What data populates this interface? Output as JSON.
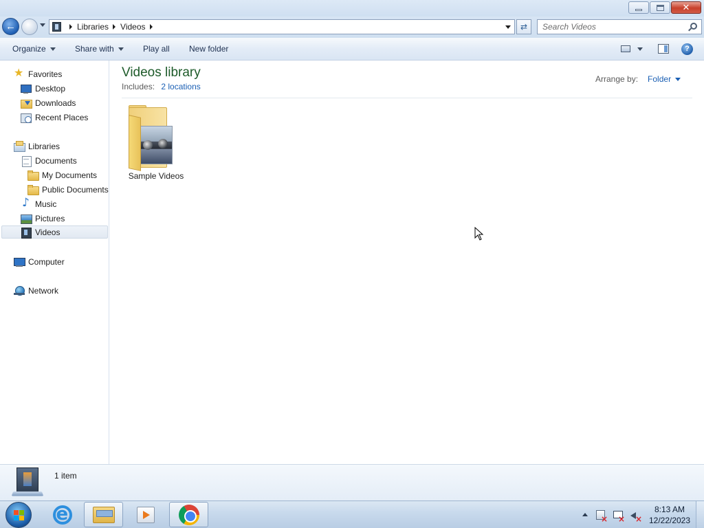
{
  "window": {
    "caption_buttons": [
      "minimize-icon",
      "restore-icon",
      "close-icon"
    ]
  },
  "address": {
    "breadcrumbs": [
      "Libraries",
      "Videos"
    ],
    "search_placeholder": "Search Videos"
  },
  "commandbar": {
    "organize": "Organize",
    "share_with": "Share with",
    "play_all": "Play all",
    "new_folder": "New folder"
  },
  "navpane": {
    "favorites": {
      "label": "Favorites",
      "items": [
        "Desktop",
        "Downloads",
        "Recent Places"
      ]
    },
    "libraries": {
      "label": "Libraries",
      "documents": "Documents",
      "document_children": [
        "My Documents",
        "Public Documents"
      ],
      "items": [
        "Music",
        "Pictures",
        "Videos"
      ],
      "selected": "Videos"
    },
    "computer": "Computer",
    "network": "Network"
  },
  "content": {
    "title": "Videos library",
    "includes_label": "Includes:",
    "includes_link": "2 locations",
    "arrange_label": "Arrange by:",
    "arrange_value": "Folder",
    "items": [
      {
        "name": "Sample Videos",
        "icon": "video-folder-icon"
      }
    ]
  },
  "details": {
    "count_text": "1 item"
  },
  "taskbar": {
    "pinned": [
      "internet-explorer-icon",
      "windows-explorer-icon",
      "media-player-icon",
      "chrome-icon"
    ],
    "active": "windows-explorer-icon",
    "clock_time": "8:13 AM",
    "clock_date": "12/22/2023"
  },
  "colors": {
    "library_title": "#1e5b2a",
    "link": "#1a5fb4",
    "taskbar": "#c7d9ec"
  }
}
